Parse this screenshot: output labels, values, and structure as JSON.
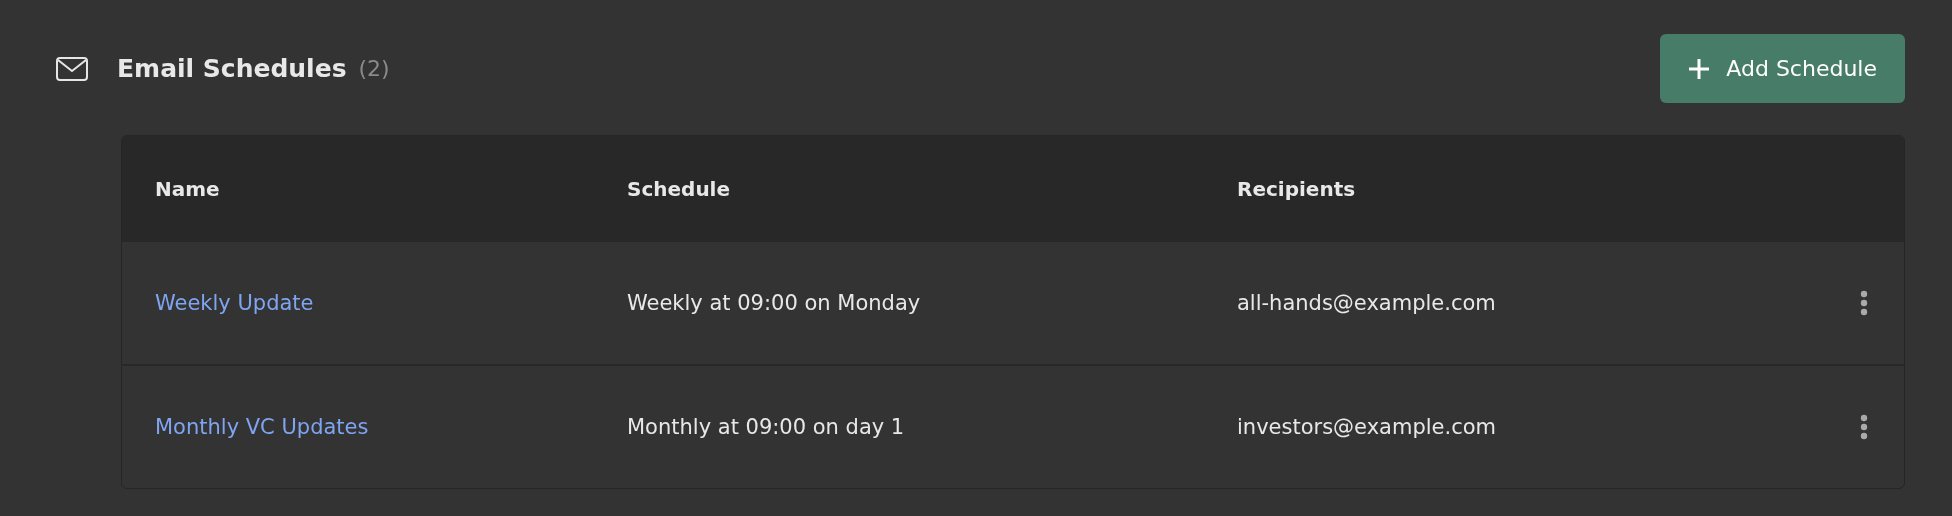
{
  "section": {
    "title": "Email Schedules",
    "count": "(2)"
  },
  "add_button": {
    "label": "Add Schedule"
  },
  "table": {
    "columns": [
      "Name",
      "Schedule",
      "Recipients"
    ],
    "rows": [
      {
        "name": "Weekly Update",
        "schedule": "Weekly at 09:00 on Monday",
        "recipients": "all-hands@example.com"
      },
      {
        "name": "Monthly VC Updates",
        "schedule": "Monthly at 09:00 on day 1",
        "recipients": "investors@example.com"
      }
    ]
  }
}
